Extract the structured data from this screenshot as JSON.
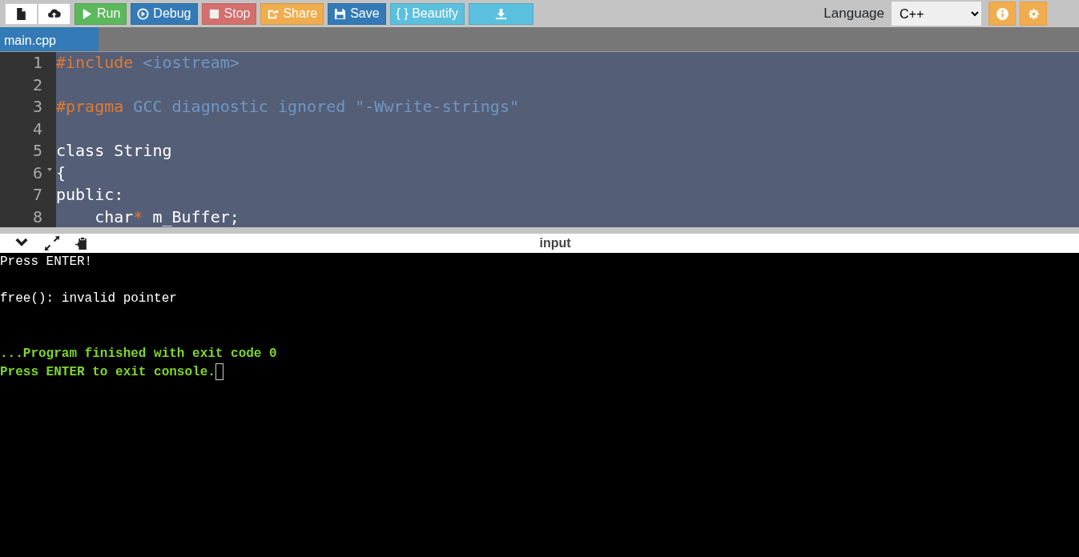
{
  "toolbar": {
    "buttons": [
      {
        "label": "Run",
        "disabled": false
      },
      {
        "label": "Debug",
        "disabled": false
      },
      {
        "label": "Stop",
        "disabled": true
      },
      {
        "label": "Share",
        "disabled": false
      },
      {
        "label": "Save",
        "disabled": false
      },
      {
        "label": "{ } Beautify",
        "disabled": false
      },
      {
        "disabled": false
      }
    ],
    "language_label": "Language",
    "language": "C++"
  },
  "tabs": [
    {
      "label": "main.cpp",
      "selected": true
    }
  ],
  "editor": {
    "lines": [
      {
        "number": "1",
        "fold": false,
        "tokens": [
          {
            "text": "#include",
            "kind": "keyword"
          },
          {
            "text": " <iostream>",
            "kind": "meta"
          }
        ]
      },
      {
        "number": "2",
        "fold": false
      },
      {
        "number": "3",
        "fold": false,
        "tokens": [
          {
            "text": "#pragma",
            "kind": "keyword"
          },
          {
            "text": " GCC diagnostic ignored \"-Wwrite-strings\"",
            "kind": "meta"
          }
        ]
      },
      {
        "number": "4",
        "fold": false
      },
      {
        "number": "5",
        "fold": false,
        "tokens": [
          {
            "text": "class String",
            "kind": "plain"
          }
        ]
      },
      {
        "number": "6",
        "fold": true,
        "tokens": [
          {
            "text": "{",
            "kind": "plain"
          }
        ]
      },
      {
        "number": "7",
        "fold": false,
        "tokens": [
          {
            "text": "public:",
            "kind": "plain"
          }
        ]
      },
      {
        "number": "8",
        "fold": false,
        "tokens": [
          {
            "text": "    char",
            "kind": "plain"
          },
          {
            "text": "*",
            "kind": "keyword"
          },
          {
            "text": " m_Buffer;",
            "kind": "plain"
          }
        ]
      }
    ]
  },
  "console": {
    "title": "input",
    "lines": [
      {
        "text": "Press ENTER!",
        "kind": "output"
      },
      {
        "kind": "blank"
      },
      {
        "text": "free(): invalid pointer",
        "kind": "output"
      },
      {
        "kind": "blank"
      },
      {
        "kind": "blank"
      },
      {
        "text": "...Program finished with exit code 0",
        "kind": "status"
      },
      {
        "text": "Press ENTER to exit console.",
        "kind": "status",
        "cursor": true
      }
    ]
  }
}
